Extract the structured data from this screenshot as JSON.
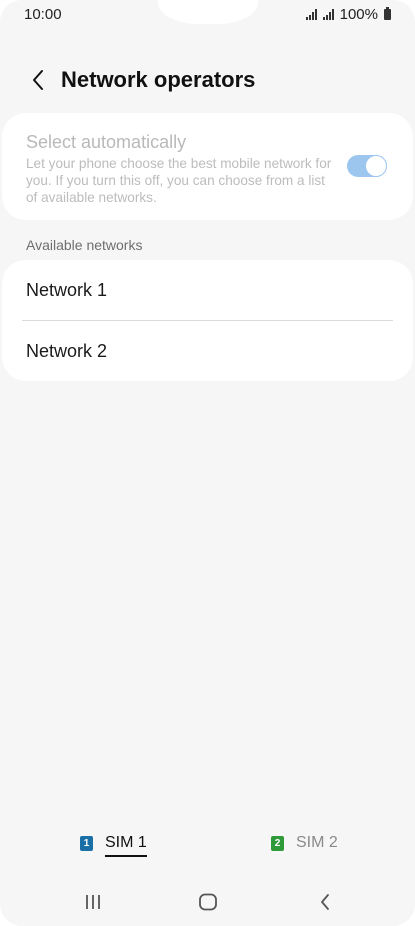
{
  "status_bar": {
    "time": "10:00",
    "battery": "100%"
  },
  "header": {
    "title": "Network operators",
    "back_icon": "chevron-left-icon"
  },
  "auto_select": {
    "title": "Select automatically",
    "description": "Let your phone choose the best mobile network for you. If you turn this off, you can choose from a list of available networks.",
    "enabled": true,
    "disabled_appearance": true
  },
  "available_networks": {
    "label": "Available networks",
    "items": [
      {
        "label": "Network 1"
      },
      {
        "label": "Network 2"
      }
    ]
  },
  "sim_tabs": [
    {
      "badge": "1",
      "label": "SIM 1",
      "selected": true,
      "badge_color": "#1a6fa6"
    },
    {
      "badge": "2",
      "label": "SIM 2",
      "selected": false,
      "badge_color": "#2e9a3a"
    }
  ],
  "nav_bar": {
    "icons": [
      "recents-icon",
      "home-icon",
      "back-icon"
    ]
  },
  "colors": {
    "toggle_track": "#9dc6ef",
    "background": "#f6f6f6",
    "card": "#ffffff"
  }
}
